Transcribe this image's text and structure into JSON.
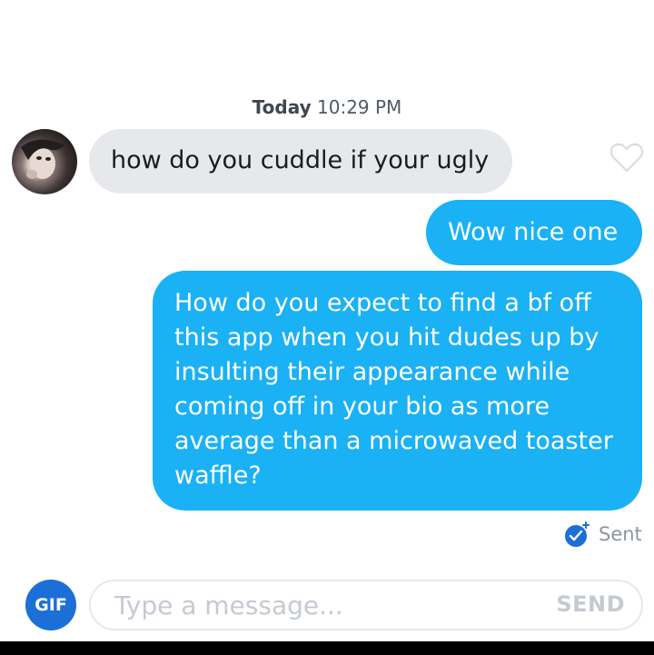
{
  "header": {
    "timestamp_day": "Today",
    "timestamp_time": "10:29 PM"
  },
  "messages": [
    {
      "direction": "incoming",
      "text": "how do you cuddle if your ugly"
    },
    {
      "direction": "outgoing",
      "text": "Wow nice one"
    },
    {
      "direction": "outgoing",
      "text": "How do you expect to find a bf off this app when you hit dudes up by insulting their appearance while coming off in your bio as more average than a microwaved toaster waffle?"
    }
  ],
  "status": {
    "sent_label": "Sent"
  },
  "composer": {
    "gif_label": "GIF",
    "placeholder": "Type a message...",
    "send_label": "SEND"
  },
  "icons": {
    "like": "heart-icon",
    "sent": "check-badge-icon",
    "avatar": "avatar"
  },
  "colors": {
    "outgoing_bubble": "#1ab1f5",
    "incoming_bubble": "#e6e8ec",
    "gif_button": "#1c6fd6",
    "sent_icon": "#1c6fd6"
  }
}
